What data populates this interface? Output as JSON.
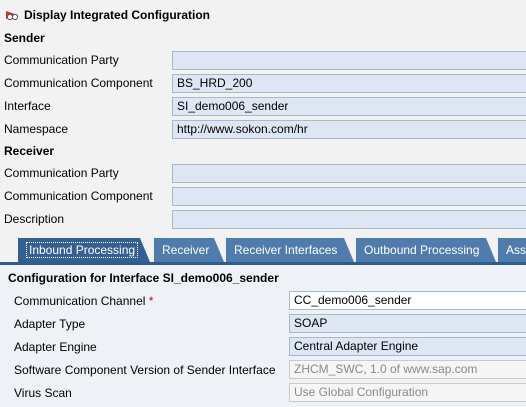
{
  "header": {
    "title": "Display Integrated Configuration",
    "icon": "glasses-icon"
  },
  "sender": {
    "heading": "Sender",
    "rows": [
      {
        "label": "Communication Party",
        "value": ""
      },
      {
        "label": "Communication Component",
        "value": "BS_HRD_200"
      },
      {
        "label": "Interface",
        "value": "SI_demo006_sender"
      },
      {
        "label": "Namespace",
        "value": "http://www.sokon.com/hr"
      }
    ]
  },
  "receiver": {
    "heading": "Receiver",
    "rows": [
      {
        "label": "Communication Party",
        "value": ""
      },
      {
        "label": "Communication Component",
        "value": ""
      },
      {
        "label": "Description",
        "value": ""
      }
    ]
  },
  "tabs": [
    {
      "label": "Inbound Processing",
      "active": true
    },
    {
      "label": "Receiver",
      "active": false
    },
    {
      "label": "Receiver Interfaces",
      "active": false
    },
    {
      "label": "Outbound Processing",
      "active": false
    },
    {
      "label": "Ass",
      "active": false
    }
  ],
  "config": {
    "heading": "Configuration for Interface SI_demo006_sender",
    "rows": [
      {
        "label": "Communication Channel",
        "required_mark": "*",
        "value": "CC_demo006_sender"
      },
      {
        "label": "Adapter Type",
        "value": "SOAP"
      },
      {
        "label": "Adapter Engine",
        "value": "Central Adapter Engine"
      },
      {
        "label": "Software Component Version of Sender Interface",
        "value": "ZHCM_SWC, 1.0 of www.sap.com"
      },
      {
        "label": "Virus Scan",
        "value": "Use Global Configuration"
      }
    ]
  },
  "colors": {
    "tab": "#4f7cac",
    "tab_active": "#355f90",
    "field": "#dde6f2",
    "required": "#cc0000"
  }
}
